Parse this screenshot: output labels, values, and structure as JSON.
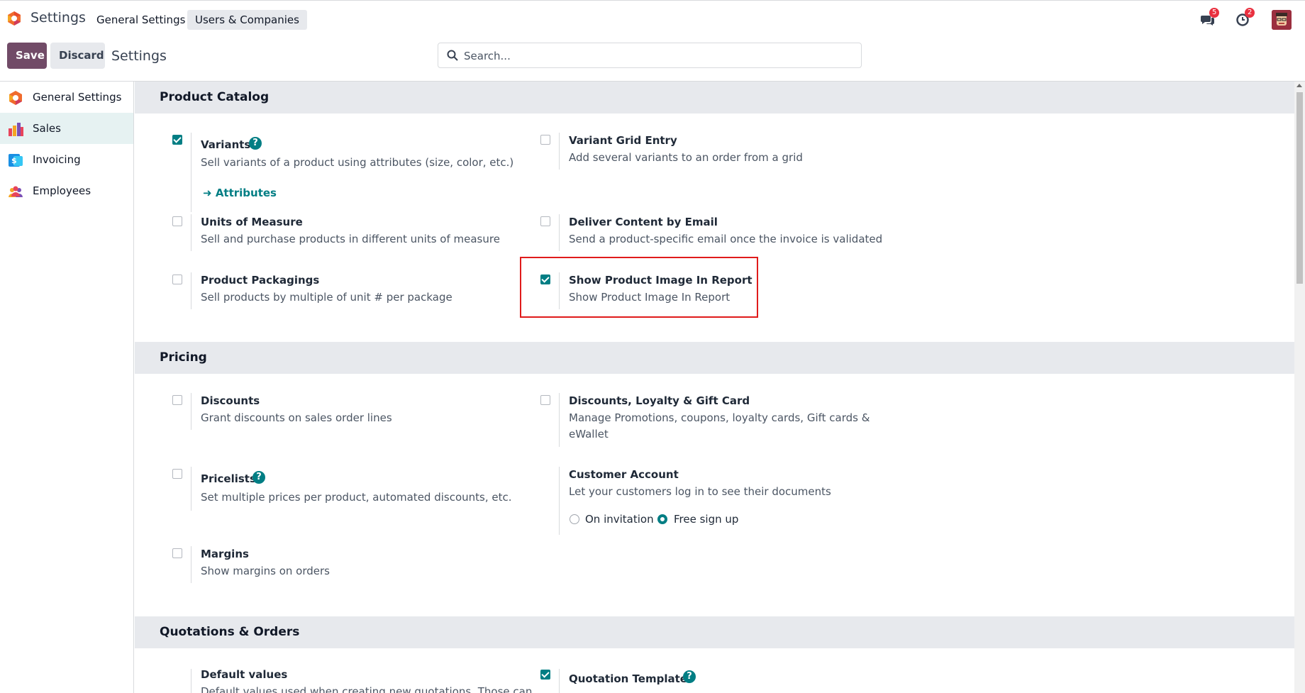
{
  "navbar": {
    "app_title": "Settings",
    "menu": [
      {
        "label": "General Settings"
      },
      {
        "label": "Users & Companies"
      }
    ],
    "messages_badge": "5",
    "activities_badge": "2"
  },
  "control_panel": {
    "save_label": "Save",
    "discard_label": "Discard",
    "breadcrumb": "Settings",
    "search_placeholder": "Search..."
  },
  "sidebar": {
    "items": [
      {
        "label": "General Settings",
        "icon": "odoo-logo-icon"
      },
      {
        "label": "Sales",
        "icon": "sales-chart-icon"
      },
      {
        "label": "Invoicing",
        "icon": "invoicing-icon"
      },
      {
        "label": "Employees",
        "icon": "employees-icon"
      }
    ]
  },
  "sections": {
    "product_catalog": {
      "title": "Product Catalog",
      "variants": {
        "title": "Variants",
        "desc": "Sell variants of a product using attributes (size, color, etc.)",
        "link": "Attributes",
        "checked": true
      },
      "variant_grid": {
        "title": "Variant Grid Entry",
        "desc": "Add several variants to an order from a grid",
        "checked": false
      },
      "uom": {
        "title": "Units of Measure",
        "desc": "Sell and purchase products in different units of measure",
        "checked": false
      },
      "deliver_email": {
        "title": "Deliver Content by Email",
        "desc": "Send a product-specific email once the invoice is validated",
        "checked": false
      },
      "packagings": {
        "title": "Product Packagings",
        "desc": "Sell products by multiple of unit # per package",
        "checked": false
      },
      "show_image": {
        "title": "Show Product Image In Report",
        "desc": "Show Product Image In Report",
        "checked": true
      }
    },
    "pricing": {
      "title": "Pricing",
      "discounts": {
        "title": "Discounts",
        "desc": "Grant discounts on sales order lines",
        "checked": false
      },
      "loyalty": {
        "title": "Discounts, Loyalty & Gift Card",
        "desc1": "Manage Promotions, coupons, loyalty cards, Gift cards &",
        "desc2": "eWallet",
        "checked": false
      },
      "pricelists": {
        "title": "Pricelists",
        "desc": "Set multiple prices per product, automated discounts, etc.",
        "checked": false
      },
      "customer_account": {
        "title": "Customer Account",
        "desc": "Let your customers log in to see their documents",
        "option1": "On invitation",
        "option2": "Free sign up",
        "selected": "Free sign up"
      },
      "margins": {
        "title": "Margins",
        "desc": "Show margins on orders",
        "checked": false
      }
    },
    "quotations": {
      "title": "Quotations & Orders",
      "default_values": {
        "title": "Default values",
        "desc": "Default values used when creating new quotations. Those can"
      },
      "templates": {
        "title": "Quotation Templates",
        "checked": true
      }
    }
  },
  "colors": {
    "primary": "#714b67",
    "accent": "#017e84",
    "highlight_box": "#e01b1b",
    "badge": "#e9303f"
  }
}
